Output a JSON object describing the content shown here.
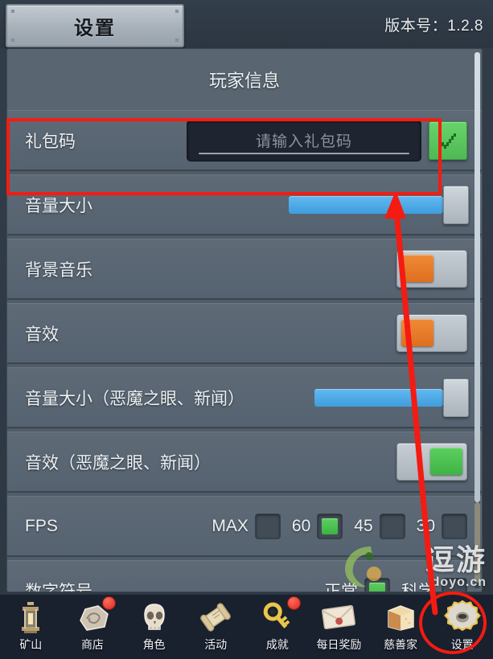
{
  "header": {
    "tab_label": "设置",
    "version_text": "版本号：1.2.8"
  },
  "panel": {
    "section_title": "玩家信息",
    "rows": [
      {
        "name": "gift-code",
        "label": "礼包码",
        "control": "input",
        "value": "",
        "placeholder": "请输入礼包码",
        "confirm_icon": "check-icon",
        "highlighted": true
      },
      {
        "name": "volume",
        "label": "音量大小",
        "control": "slider",
        "value": 100
      },
      {
        "name": "bgm",
        "label": "背景音乐",
        "control": "toggle",
        "state": "off"
      },
      {
        "name": "sfx",
        "label": "音效",
        "control": "toggle",
        "state": "off"
      },
      {
        "name": "volume-demon-eye-news",
        "label": "音量大小（恶魔之眼、新闻）",
        "control": "slider",
        "value": 100
      },
      {
        "name": "sfx-demon-eye-news",
        "label": "音效（恶魔之眼、新闻）",
        "control": "toggle",
        "state": "on"
      },
      {
        "name": "fps",
        "label": "FPS",
        "control": "checkbox-group",
        "options": [
          {
            "label": "MAX",
            "checked": false
          },
          {
            "label": "60",
            "checked": true
          },
          {
            "label": "45",
            "checked": false
          },
          {
            "label": "30",
            "checked": false
          }
        ]
      },
      {
        "name": "number-format",
        "label": "数字符号",
        "control": "checkbox-group",
        "options": [
          {
            "label": "正常",
            "checked": true
          },
          {
            "label": "科学",
            "checked": false
          }
        ]
      }
    ]
  },
  "bottom_nav": [
    {
      "label": "矿山",
      "icon": "lantern-icon",
      "badge": false,
      "selected": false
    },
    {
      "label": "商店",
      "icon": "rock-icon",
      "badge": true,
      "selected": false
    },
    {
      "label": "角色",
      "icon": "skull-icon",
      "badge": false,
      "selected": false
    },
    {
      "label": "活动",
      "icon": "scroll-icon",
      "badge": false,
      "selected": false
    },
    {
      "label": "成就",
      "icon": "key-icon",
      "badge": true,
      "selected": false
    },
    {
      "label": "每日奖励",
      "icon": "envelope-icon",
      "badge": false,
      "selected": false
    },
    {
      "label": "慈善家",
      "icon": "bread-icon",
      "badge": false,
      "selected": false
    },
    {
      "label": "设置",
      "icon": "gear-icon",
      "badge": false,
      "selected": true
    }
  ],
  "watermark": {
    "main": "逗游",
    "sub": "doyo.cn"
  },
  "colors": {
    "accent_blue": "#4ba8e8",
    "toggle_off": "#e07a2e",
    "toggle_on": "#4cc24c",
    "confirm_green": "#5bc95b",
    "annotation_red": "#f41b12",
    "panel_bg": "#505c67",
    "row_bg": "#5a6670",
    "bottom_bar": "#19202e"
  }
}
